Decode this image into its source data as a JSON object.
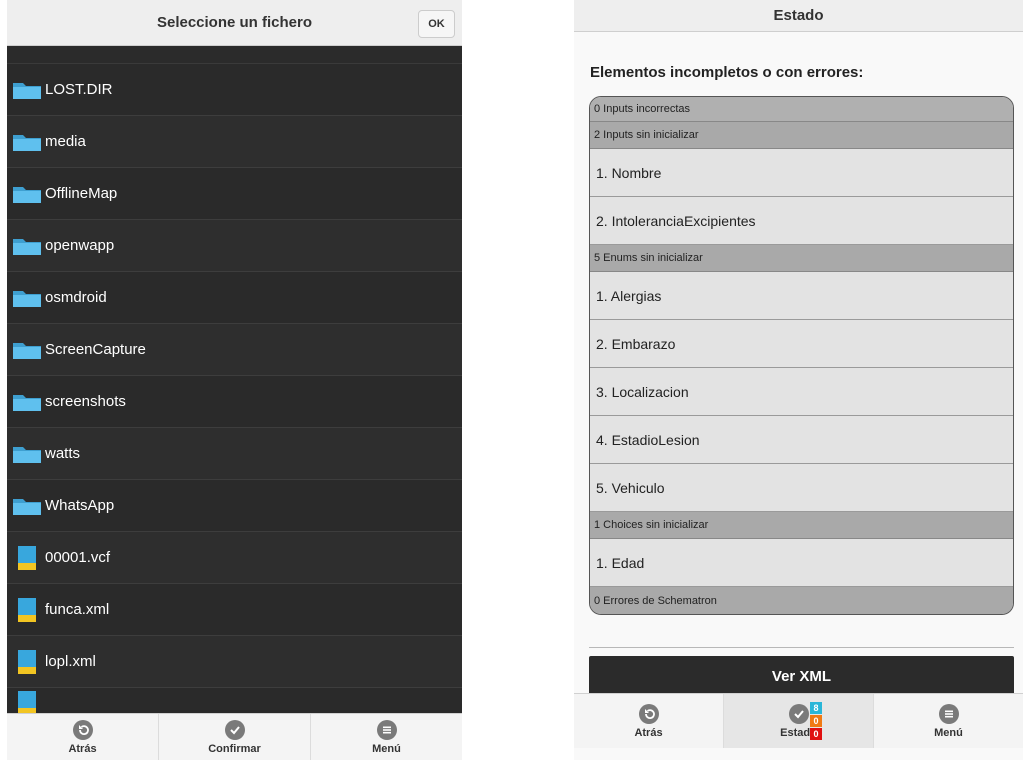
{
  "file_chooser": {
    "title": "Seleccione un fichero",
    "ok_label": "OK",
    "items": [
      {
        "name": "LOST.DIR",
        "type": "folder"
      },
      {
        "name": "media",
        "type": "folder"
      },
      {
        "name": "OfflineMap",
        "type": "folder"
      },
      {
        "name": "openwapp",
        "type": "folder"
      },
      {
        "name": "osmdroid",
        "type": "folder"
      },
      {
        "name": "ScreenCapture",
        "type": "folder"
      },
      {
        "name": "screenshots",
        "type": "folder"
      },
      {
        "name": "watts",
        "type": "folder"
      },
      {
        "name": "WhatsApp",
        "type": "folder"
      },
      {
        "name": "00001.vcf",
        "type": "file"
      },
      {
        "name": "funca.xml",
        "type": "file"
      },
      {
        "name": "lopl.xml",
        "type": "file"
      }
    ],
    "footer": {
      "back_label": "Atrás",
      "confirm_label": "Confirmar",
      "menu_label": "Menú"
    }
  },
  "status_screen": {
    "title": "Estado",
    "heading": "Elementos incompletos o con errores:",
    "groups": [
      {
        "header": "0 Inputs incorrectas",
        "items": []
      },
      {
        "header": "2 Inputs sin inicializar",
        "items": [
          "1. Nombre",
          "2. IntoleranciaExcipientes"
        ]
      },
      {
        "header": "5 Enums sin inicializar",
        "items": [
          "1. Alergias",
          "2. Embarazo",
          "3. Localizacion",
          "4. EstadioLesion",
          "5. Vehiculo"
        ]
      },
      {
        "header": "1 Choices sin inicializar",
        "items": [
          "1. Edad"
        ]
      },
      {
        "header": "0 Errores de Schematron",
        "items": []
      }
    ],
    "ver_xml_label": "Ver XML",
    "footer": {
      "back_label": "Atrás",
      "status_label": "Estado",
      "menu_label": "Menú",
      "badges": [
        {
          "value": "8",
          "color": "#29b6d8"
        },
        {
          "value": "0",
          "color": "#f07a14"
        },
        {
          "value": "0",
          "color": "#e01010"
        }
      ]
    }
  },
  "colors": {
    "dark_bg": "#2b2b2b",
    "header_bg": "#eeeeee",
    "group_header_bg": "#a9a9a9",
    "item_bg": "#e3e3e3",
    "folder_blue": "#4fb6e6",
    "doc_yellow": "#f2c522"
  }
}
